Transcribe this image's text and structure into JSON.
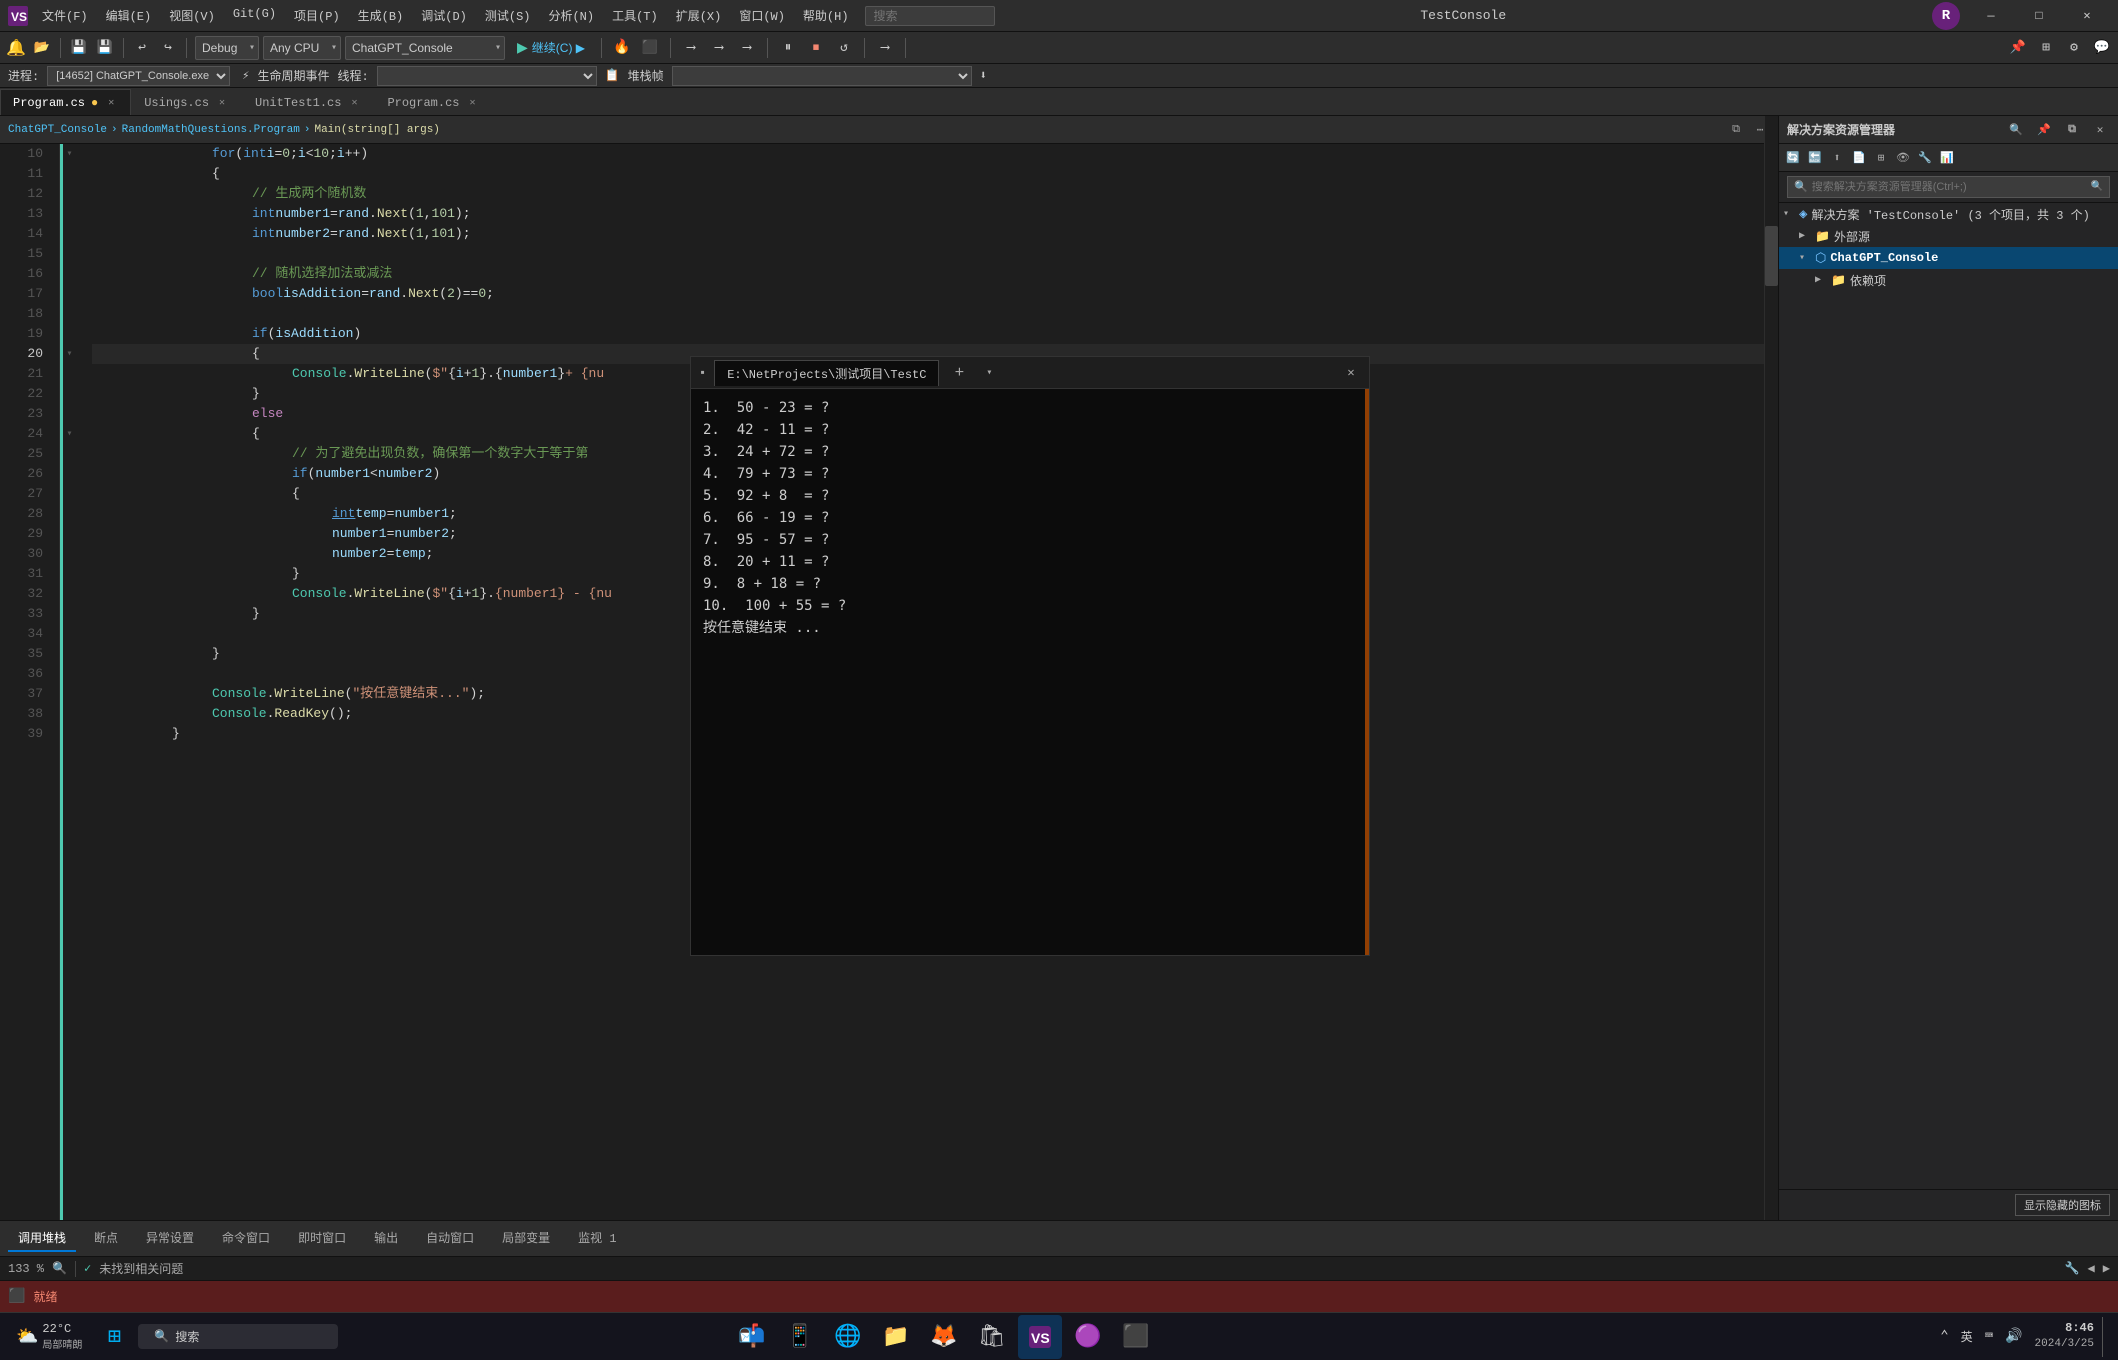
{
  "titlebar": {
    "logo": "VS",
    "menus": [
      "文件(F)",
      "编辑(E)",
      "视图(V)",
      "Git(G)",
      "项目(P)",
      "生成(B)",
      "调试(D)",
      "测试(S)",
      "分析(N)",
      "工具(T)",
      "扩展(X)",
      "窗口(W)",
      "帮助(H)"
    ],
    "search_placeholder": "搜索",
    "title": "TestConsole",
    "min_label": "—",
    "max_label": "□",
    "close_label": "✕"
  },
  "toolbar": {
    "debug_config": "Debug",
    "cpu_config": "Any CPU",
    "app_config": "ChatGPT_Console",
    "start_label": "继续(C) ▶",
    "play_icon": "▶"
  },
  "process_bar": {
    "prefix": "进程:",
    "process": "[14652] ChatGPT_Console.exe",
    "lifecycle_label": "生命周期事件",
    "thread_label": "线程:",
    "callstack_label": "堆栈帧"
  },
  "tabs": [
    {
      "label": "Program.cs",
      "active": true,
      "modified": false
    },
    {
      "label": "Usings.cs",
      "active": false
    },
    {
      "label": "UnitTest1.cs",
      "active": false
    },
    {
      "label": "Program.cs",
      "active": false
    }
  ],
  "editor": {
    "breadcrumb_project": "ChatGPT_Console",
    "breadcrumb_class": "RandomMathQuestions.Program",
    "breadcrumb_method": "Main(string[] args)",
    "zoom": "133 %",
    "status": "未找到相关问题"
  },
  "code_lines": [
    {
      "num": 10,
      "text": "for (int i = 0; i < 10; i++)",
      "indent": 12
    },
    {
      "num": 11,
      "text": "{",
      "indent": 12
    },
    {
      "num": 12,
      "text": "// 生成两个随机数",
      "indent": 16
    },
    {
      "num": 13,
      "text": "int number1 = rand.Next(1, 101);",
      "indent": 16
    },
    {
      "num": 14,
      "text": "int number2 = rand.Next(1, 101);",
      "indent": 16
    },
    {
      "num": 15,
      "text": "",
      "indent": 0
    },
    {
      "num": 16,
      "text": "// 随机选择加法或减法",
      "indent": 16
    },
    {
      "num": 17,
      "text": "bool isAddition = rand.Next(2) == 0;",
      "indent": 16
    },
    {
      "num": 18,
      "text": "",
      "indent": 0
    },
    {
      "num": 19,
      "text": "if (isAddition)",
      "indent": 16
    },
    {
      "num": 20,
      "text": "{",
      "indent": 16
    },
    {
      "num": 21,
      "text": "Console.WriteLine($\"{i + 1}.  {number1} + {nu",
      "indent": 20
    },
    {
      "num": 22,
      "text": "}",
      "indent": 16
    },
    {
      "num": 23,
      "text": "else",
      "indent": 16
    },
    {
      "num": 24,
      "text": "{",
      "indent": 16
    },
    {
      "num": 25,
      "text": "// 为了避免出现负数，确保第一个数字大于等于",
      "indent": 20
    },
    {
      "num": 26,
      "text": "if (number1 < number2)",
      "indent": 20
    },
    {
      "num": 27,
      "text": "{",
      "indent": 20
    },
    {
      "num": 28,
      "text": "int temp = number1;",
      "indent": 24
    },
    {
      "num": 29,
      "text": "number1 = number2;",
      "indent": 24
    },
    {
      "num": 30,
      "text": "number2 = temp;",
      "indent": 24
    },
    {
      "num": 31,
      "text": "}",
      "indent": 20
    },
    {
      "num": 32,
      "text": "Console.WriteLine($\"{i + 1}.  {number1} - {nu",
      "indent": 20
    },
    {
      "num": 33,
      "text": "}",
      "indent": 16
    },
    {
      "num": 34,
      "text": "",
      "indent": 0
    },
    {
      "num": 35,
      "text": "}",
      "indent": 12
    },
    {
      "num": 36,
      "text": "",
      "indent": 0
    },
    {
      "num": 37,
      "text": "Console.WriteLine(\"按任意键结束...\");",
      "indent": 12
    },
    {
      "num": 38,
      "text": "Console.ReadKey();",
      "indent": 12
    },
    {
      "num": 39,
      "text": "}",
      "indent": 8
    }
  ],
  "solution_explorer": {
    "title": "解决方案资源管理器",
    "search_placeholder": "搜索解决方案资源管理器(Ctrl+;)",
    "solution_label": "解决方案 'TestConsole' (3 个项目，共 3 个)",
    "items": [
      {
        "label": "外部源",
        "level": 1,
        "type": "folder",
        "expanded": false
      },
      {
        "label": "ChatGPT_Console",
        "level": 1,
        "type": "project",
        "expanded": true,
        "selected": true
      },
      {
        "label": "依赖项",
        "level": 2,
        "type": "folder",
        "expanded": false
      }
    ]
  },
  "console": {
    "title": "E:\\NetProjects\\测试项目\\TestC",
    "lines": [
      "1.  50 - 23 = ?",
      "2.  42 - 11 = ?",
      "3.  24 + 72 = ?",
      "4.  79 + 73 = ?",
      "5.  92 + 8  = ?",
      "6.  66 - 19 = ?",
      "7.  95 - 57 = ?",
      "8.  20 + 11 = ?",
      "9.  8 + 18 = ?",
      "10.  100 + 55 = ?",
      "按任意键结束 ..."
    ]
  },
  "bottom_tabs": [
    "调用堆栈",
    "断点",
    "异常设置",
    "命令窗口",
    "即时窗口",
    "输出",
    "自动窗口",
    "局部变量",
    "监视 1"
  ],
  "status_bar": {
    "error_label": "就绪"
  },
  "taskbar": {
    "weather_temp": "22°C",
    "weather_desc": "局部晴朗",
    "search_placeholder": "搜索",
    "clock_time": "8:46",
    "clock_date": "2024/3/25",
    "lang": "英",
    "show_desktop": "显示隐藏的图标"
  },
  "icons": {
    "search": "🔍",
    "gear": "⚙",
    "close": "✕",
    "minimize": "—",
    "maximize": "□",
    "play": "▶",
    "pause": "⏸",
    "stop": "⏹",
    "restart": "↺",
    "folder": "📁",
    "project": "📦",
    "file": "📄",
    "chevron_right": "›",
    "chevron_down": "▾",
    "pin": "📌",
    "windows": "⊞",
    "terminal": ">_"
  }
}
